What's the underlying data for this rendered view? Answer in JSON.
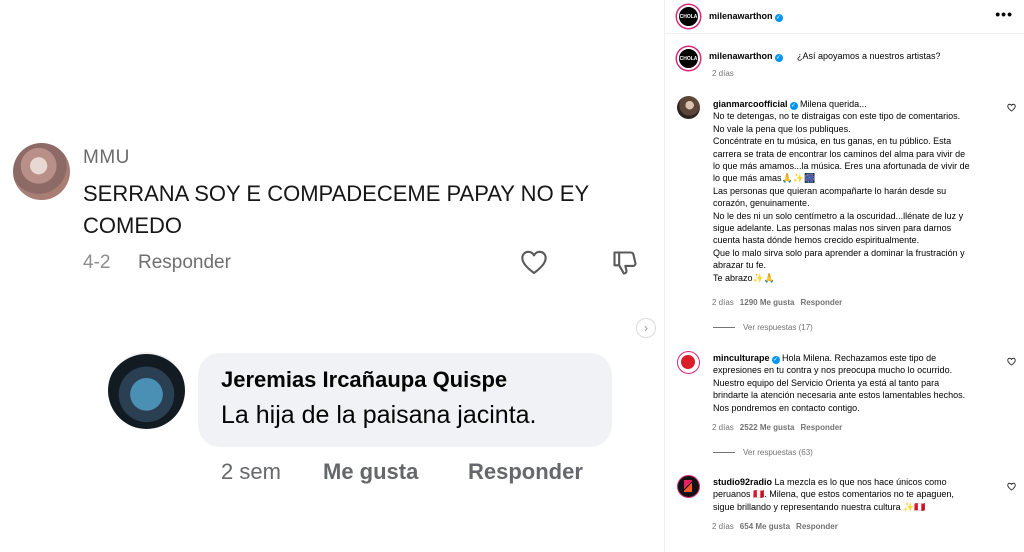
{
  "screenshot": {
    "comment1": {
      "username": "MMU",
      "text": "SERRANA SOY E COMPADECEME PAPAY NO EY COMEDO",
      "time": "4-2",
      "reply_label": "Responder"
    },
    "comment2": {
      "username": "Jeremias Ircañaupa Quispe",
      "text": "La hija de la paisana jacinta.",
      "time": "2 sem",
      "like_label": "Me gusta",
      "reply_label": "Responder"
    }
  },
  "post": {
    "header": {
      "username": "milenawarthon",
      "avatar_text": "CHOLA",
      "more_glyph": "•••"
    },
    "caption": {
      "username": "milenawarthon",
      "text": "¿Así apoyamos a nuestros artistas?",
      "time": "2 días"
    },
    "comments": [
      {
        "username": "gianmarcoofficial",
        "lines": [
          "Milena querida...",
          "No te detengas, no te distraigas con este tipo de comentarios.",
          "No vale la pena que los publiques.",
          "Concéntrate en tu música, en tus ganas, en tu público. Esta",
          "carrera se trata de encontrar los caminos del alma para vivir de",
          "lo que más amamos...la música. Eres una afortunada de vivir de",
          "lo que más amas🙏✨🎆",
          "Las personas que quieran acompañarte lo harán desde su",
          "corazón, genuinamente.",
          "No le des ni un solo centímetro a la oscuridad...llénate de luz y",
          "sigue adelante. Las personas malas nos sirven para darnos",
          "cuenta hasta dónde hemos crecido espiritualmente.",
          "Que lo malo sirva solo para aprender a dominar la frustración y",
          "abrazar tu fe.",
          "Te abrazo✨🙏"
        ],
        "time": "2 días",
        "likes": "1290 Me gusta",
        "reply_label": "Responder",
        "view_replies": "Ver respuestas (17)"
      },
      {
        "username": "minculturape",
        "lines": [
          "Hola Milena. Rechazamos este tipo de",
          "expresiones en tu contra y nos preocupa mucho lo ocurrido.",
          "Nuestro equipo del Servicio Orienta ya está al tanto para",
          "brindarte la atención necesaria ante estos lamentables hechos.",
          "Nos pondremos en contacto contigo."
        ],
        "time": "2 días",
        "likes": "2522 Me gusta",
        "reply_label": "Responder",
        "view_replies": "Ver respuestas (63)"
      },
      {
        "username": "studio92radio",
        "lines": [
          "La mezcla es lo que nos hace únicos como",
          "peruanos 🇵🇪. Milena, que estos comentarios no te apaguen,",
          "sigue brillando y representando nuestra cultura ✨🇵🇪"
        ],
        "time": "2 días",
        "likes": "654 Me gusta",
        "reply_label": "Responder"
      }
    ]
  },
  "colors": {
    "accent": "#0095f6",
    "ring": "#d62976",
    "muted": "#737373"
  }
}
